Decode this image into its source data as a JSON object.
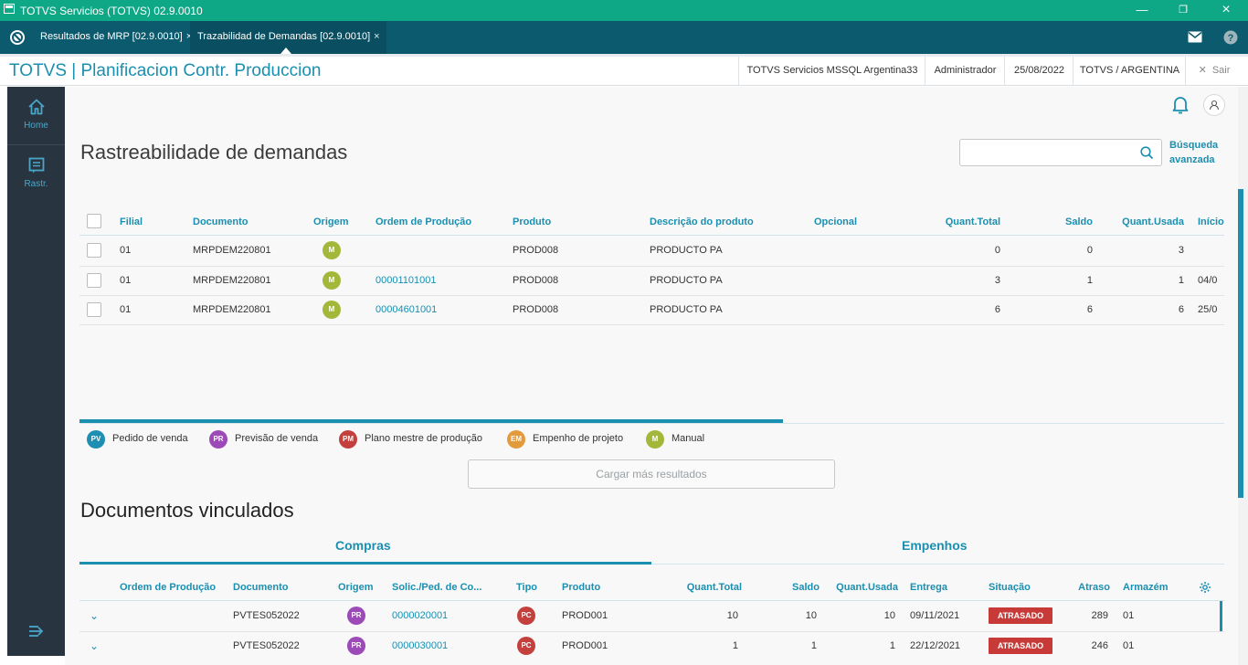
{
  "titlebar": {
    "title": "TOTVS Servicios (TOTVS) 02.9.0010"
  },
  "tabs": [
    {
      "label": "Resultados de MRP [02.9.0010]"
    },
    {
      "label": "Trazabilidad de Demandas [02.9.0010]"
    }
  ],
  "header": {
    "app_title": "TOTVS | Planificacion Contr. Produccion",
    "server": "TOTVS Servicios MSSQL Argentina33",
    "user": "Administrador",
    "date": "25/08/2022",
    "company": "TOTVS / ARGENTINA",
    "exit_label": "Sair"
  },
  "sidebar": {
    "items": [
      {
        "label": "Home",
        "icon": "home-icon"
      },
      {
        "label": "Rastr.",
        "icon": "list-icon"
      }
    ]
  },
  "page": {
    "title": "Rastreabilidade de demandas",
    "search_placeholder": "",
    "advanced_search": "Búsqueda avanzada"
  },
  "demands": {
    "columns": [
      "Filial",
      "Documento",
      "Origem",
      "Ordem de Produção",
      "Produto",
      "Descrição do produto",
      "Opcional",
      "Quant.Total",
      "Saldo",
      "Quant.Usada",
      "Início"
    ],
    "rows": [
      {
        "filial": "01",
        "documento": "MRPDEM220801",
        "origem": "M",
        "ordem": "",
        "produto": "PROD008",
        "descricao": "PRODUCTO PA",
        "opcional": "",
        "quant_total": "0",
        "saldo": "0",
        "quant_usada": "3",
        "inicio": ""
      },
      {
        "filial": "01",
        "documento": "MRPDEM220801",
        "origem": "M",
        "ordem": "00001101001",
        "produto": "PROD008",
        "descricao": "PRODUCTO PA",
        "opcional": "",
        "quant_total": "3",
        "saldo": "1",
        "quant_usada": "1",
        "inicio": "04/0"
      },
      {
        "filial": "01",
        "documento": "MRPDEM220801",
        "origem": "M",
        "ordem": "00004601001",
        "produto": "PROD008",
        "descricao": "PRODUCTO PA",
        "opcional": "",
        "quant_total": "6",
        "saldo": "6",
        "quant_usada": "6",
        "inicio": "25/0"
      }
    ]
  },
  "legend": [
    {
      "code": "PV",
      "label": "Pedido de venda",
      "color": "#1e8fb2"
    },
    {
      "code": "PR",
      "label": "Previsão de venda",
      "color": "#9c4ab8"
    },
    {
      "code": "PM",
      "label": "Plano mestre de produção",
      "color": "#c4403d"
    },
    {
      "code": "EM",
      "label": "Empenho de projeto",
      "color": "#e39a3d"
    },
    {
      "code": "M",
      "label": "Manual",
      "color": "#a3b83a"
    }
  ],
  "load_more": "Cargar más resultados",
  "linked": {
    "title": "Documentos vinculados",
    "tabs": [
      "Compras",
      "Empenhos"
    ],
    "columns": [
      "Ordem de Produção",
      "Documento",
      "Origem",
      "Solic./Ped. de Co...",
      "Tipo",
      "Produto",
      "Quant.Total",
      "Saldo",
      "Quant.Usada",
      "Entrega",
      "Situação",
      "Atraso",
      "Armazém"
    ],
    "rows": [
      {
        "ordem": "",
        "documento": "PVTES052022",
        "origem": "PR",
        "solic": "0000020001",
        "tipo": "PC",
        "produto": "PROD001",
        "quant_total": "10",
        "saldo": "10",
        "quant_usada": "10",
        "entrega": "09/11/2021",
        "situacao": "ATRASADO",
        "atraso": "289",
        "armazem": "01"
      },
      {
        "ordem": "",
        "documento": "PVTES052022",
        "origem": "PR",
        "solic": "0000030001",
        "tipo": "PC",
        "produto": "PROD001",
        "quant_total": "1",
        "saldo": "1",
        "quant_usada": "1",
        "entrega": "22/12/2021",
        "situacao": "ATRASADO",
        "atraso": "246",
        "armazem": "01"
      }
    ]
  }
}
